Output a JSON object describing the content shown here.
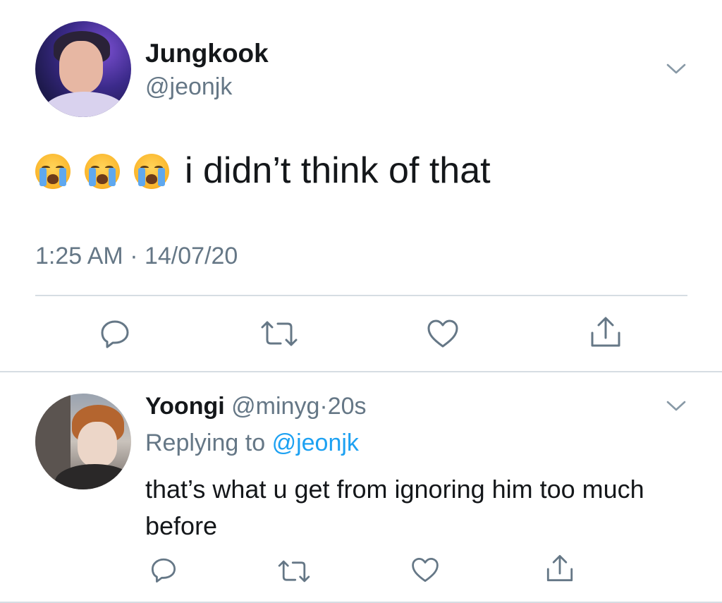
{
  "tweet": {
    "display_name": "Jungkook",
    "handle": "@jeonjk",
    "emojis": [
      "loudly-crying-face",
      "loudly-crying-face",
      "loudly-crying-face"
    ],
    "text": "i didn’t think of that",
    "time": "1:25 AM",
    "separator": "·",
    "date": "14/07/20",
    "actions": [
      "reply-icon",
      "retweet-icon",
      "like-icon",
      "share-icon"
    ]
  },
  "reply": {
    "display_name": "Yoongi",
    "handle": "@minyg",
    "separator": "·",
    "age": "20s",
    "replying_to_label": "Replying to",
    "replying_to_handle": "@jeonjk",
    "text": "that’s what u get from ignoring him too much before",
    "actions": [
      "reply-icon",
      "retweet-icon",
      "like-icon",
      "share-icon"
    ]
  },
  "colors": {
    "text_primary": "#14171a",
    "text_secondary": "#657786",
    "link": "#1da1f2",
    "divider": "#d6dde3"
  }
}
